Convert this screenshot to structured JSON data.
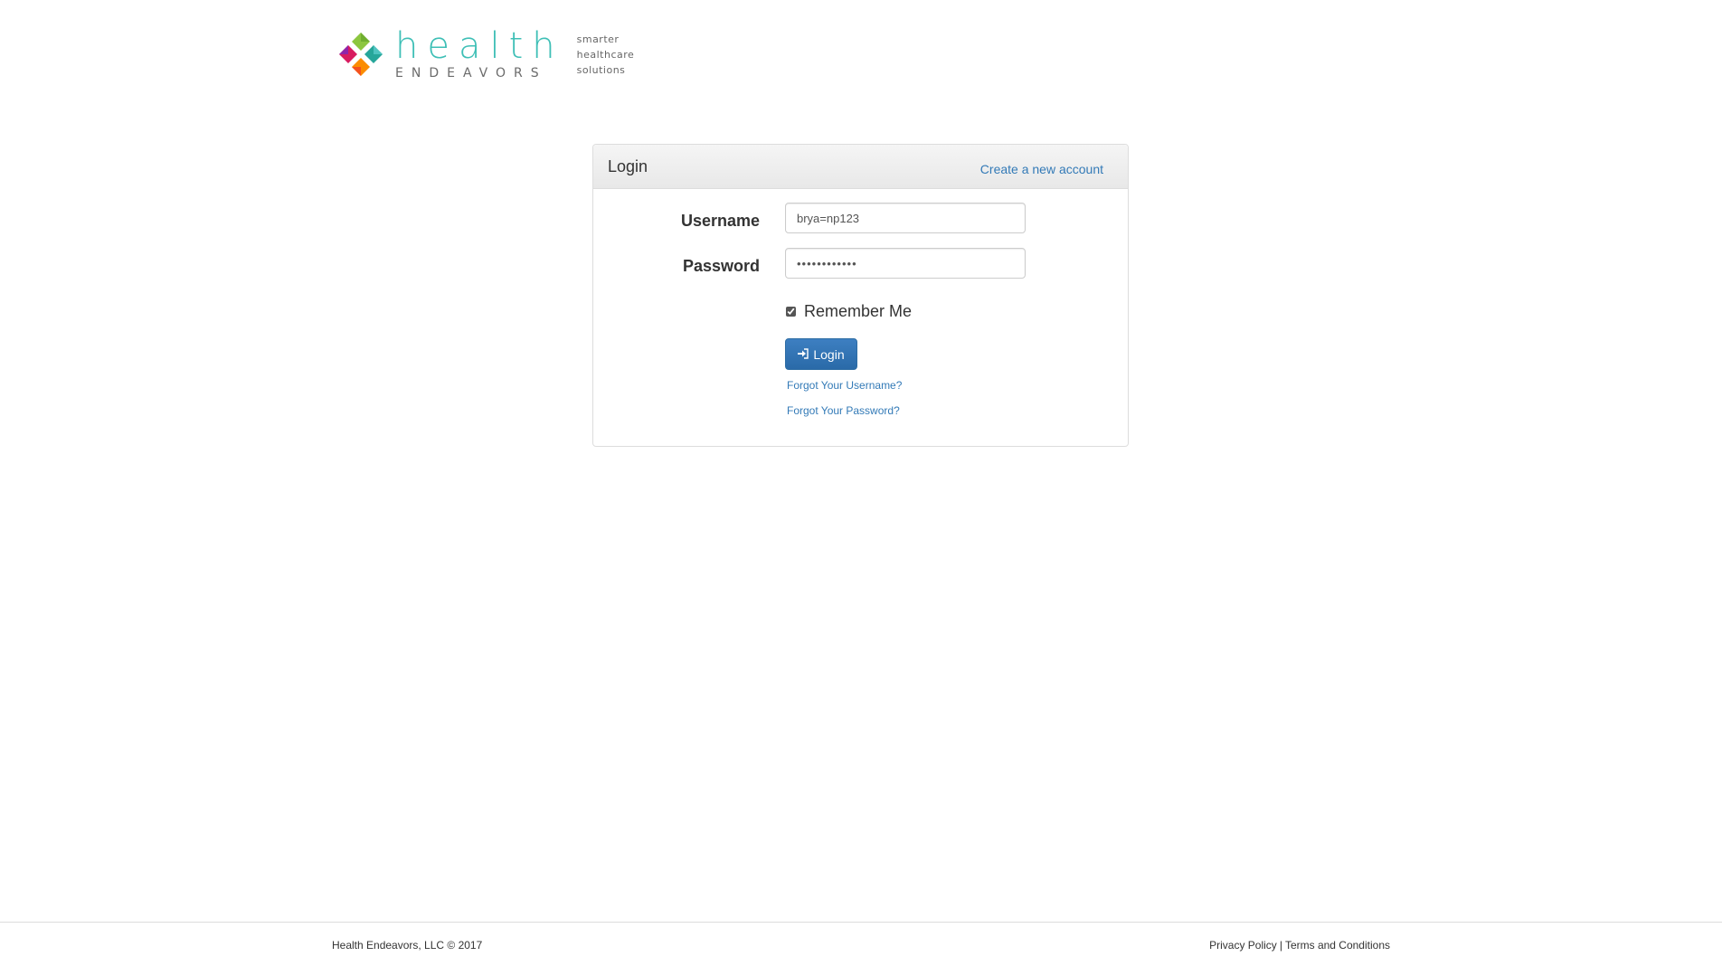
{
  "logo": {
    "wordmark": "health",
    "subwordmark": "ENDEAVORS",
    "tagline": [
      "smarter",
      "healthcare",
      "solutions"
    ]
  },
  "panel": {
    "title": "Login",
    "create_account_link": "Create a new account"
  },
  "form": {
    "username_label": "Username",
    "username_value": "brya=np123",
    "password_label": "Password",
    "password_value": "••••••••••••",
    "remember_label": "Remember Me",
    "remember_checked": true,
    "login_button": "Login",
    "forgot_username": "Forgot Your Username?",
    "forgot_password": "Forgot Your Password?"
  },
  "footer": {
    "copyright": "Health Endeavors, LLC © 2017",
    "privacy": "Privacy Policy",
    "separator": "|",
    "terms": "Terms and Conditions"
  },
  "colors": {
    "brand_teal": "#3ebfb6",
    "link_blue": "#337ab7",
    "button_blue": "#2a6aa8",
    "logo_green": "#8cc63f",
    "logo_magenta": "#c2185b",
    "logo_orange": "#f57c00",
    "logo_teal": "#26a69a"
  }
}
